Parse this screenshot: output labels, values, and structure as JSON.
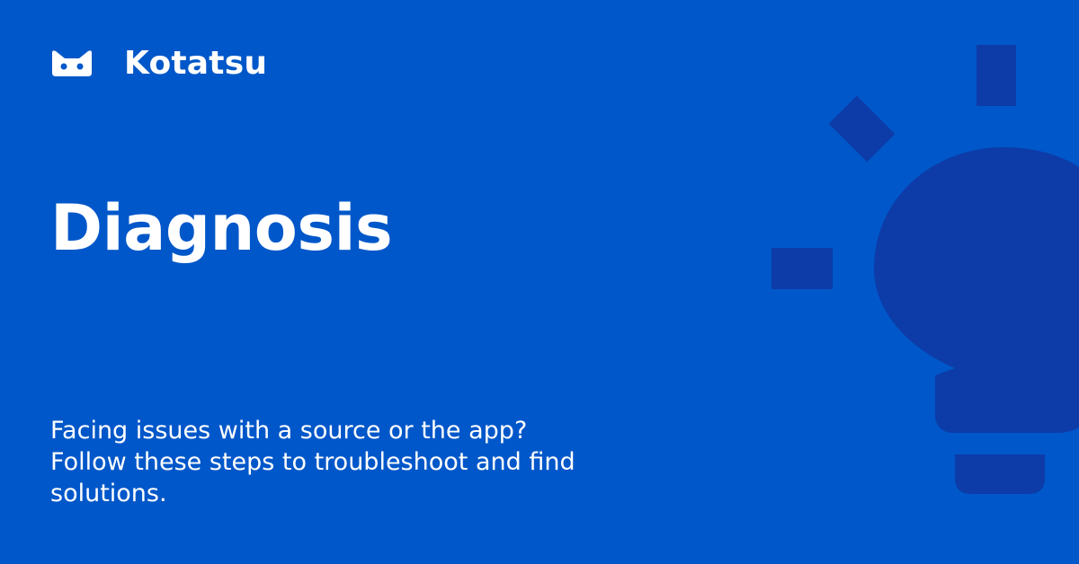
{
  "brand": {
    "name": "Kotatsu",
    "logo_icon": "cat-icon"
  },
  "page": {
    "title": "Diagnosis",
    "description_lines": [
      "Facing issues with a source or the app?",
      "Follow these steps to troubleshoot and find",
      "solutions."
    ]
  },
  "illustration": {
    "icon": "lightbulb-icon"
  },
  "colors": {
    "background": "#0057C9",
    "bulb": "#0D3BA8",
    "text": "#FFFFFF"
  }
}
